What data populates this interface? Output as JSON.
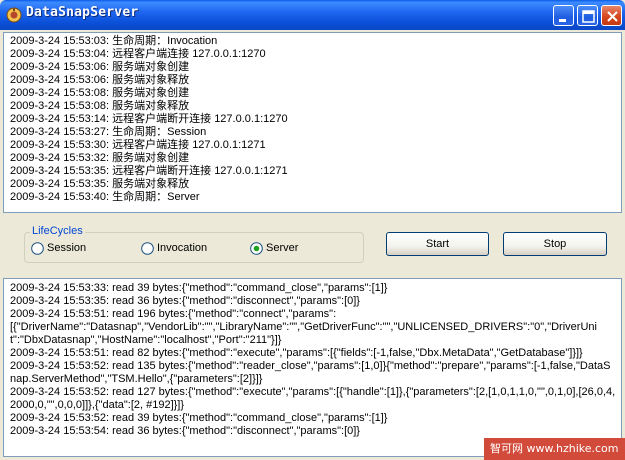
{
  "window": {
    "title": "DataSnapServer"
  },
  "top_log": [
    "2009-3-24 15:53:03: 生命周期：Invocation",
    "2009-3-24 15:53:04: 远程客户端连接 127.0.0.1:1270",
    "2009-3-24 15:53:06: 服务端对象创建",
    "2009-3-24 15:53:06: 服务端对象释放",
    "2009-3-24 15:53:08: 服务端对象创建",
    "2009-3-24 15:53:08: 服务端对象释放",
    "2009-3-24 15:53:14: 远程客户端断开连接 127.0.0.1:1270",
    "2009-3-24 15:53:27: 生命周期：Session",
    "2009-3-24 15:53:30: 远程客户端连接 127.0.0.1:1271",
    "2009-3-24 15:53:32: 服务端对象创建",
    "2009-3-24 15:53:35: 远程客户端断开连接 127.0.0.1:1271",
    "2009-3-24 15:53:35: 服务端对象释放",
    "2009-3-24 15:53:40: 生命周期：Server"
  ],
  "lifecycles": {
    "legend": "LifeCycles",
    "options": [
      "Session",
      "Invocation",
      "Server"
    ],
    "selected": "Server"
  },
  "buttons": {
    "start": "Start",
    "stop": "Stop"
  },
  "bottom_log": [
    "2009-3-24 15:53:33: read 39 bytes:{\"method\":\"command_close\",\"params\":[1]}",
    "2009-3-24 15:53:35: read 36 bytes:{\"method\":\"disconnect\",\"params\":[0]}",
    "2009-3-24 15:53:51: read 196 bytes:{\"method\":\"connect\",\"params\":",
    "[{\"DriverName\":\"Datasnap\",\"VendorLib\":\"\",\"LibraryName\":\"\",\"GetDriverFunc\":\"\",\"UNLICENSED_DRIVERS\":\"0\",\"DriverUnit\":\"DbxDatasnap\",\"HostName\":\"localhost\",\"Port\":\"211\"}]}",
    "2009-3-24 15:53:51: read 82 bytes:{\"method\":\"execute\",\"params\":[{\"fields\":[-1,false,\"Dbx.MetaData\",\"GetDatabase\"]}]}",
    "2009-3-24 15:53:52: read 135 bytes:{\"method\":\"reader_close\",\"params\":[1,0]}{\"method\":\"prepare\",\"params\":[-1,false,\"DataSnap.ServerMethod\",\"TSM.Hello\",{\"parameters\":[2]}]}",
    "2009-3-24 15:53:52: read 127 bytes:{\"method\":\"execute\",\"params\":[{\"handle\":[1]},{\"parameters\":[2,[1,0,1,1,0,\"\",0,1,0],[26,0,4,2000,0,\"\",0,0,0]]},{\"data\":[2, #192]}]}",
    "2009-3-24 15:53:52: read 39 bytes:{\"method\":\"command_close\",\"params\":[1]}",
    "2009-3-24 15:53:54: read 36 bytes:{\"method\":\"disconnect\",\"params\":[0]}"
  ],
  "watermark": {
    "text": "智可网 www.hzhike.com"
  },
  "colors": {
    "title_bar": "#0B50D8",
    "group_legend": "#0046D5",
    "close_button": "#D6471E",
    "radio_dot": "#21A121"
  }
}
